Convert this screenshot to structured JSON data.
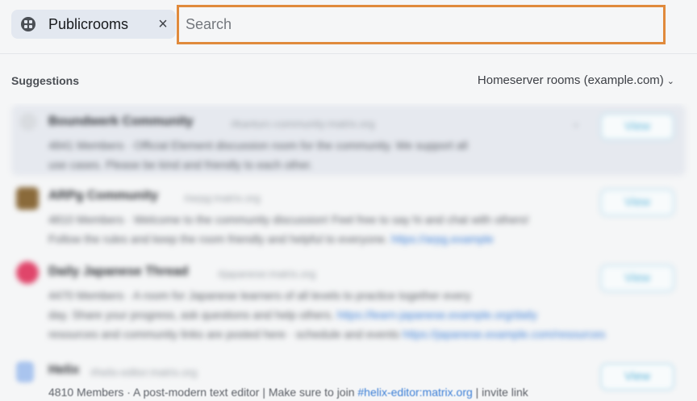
{
  "filter_chip": {
    "label": "Publicrooms",
    "icon": "public-rooms-icon",
    "close_symbol": "×"
  },
  "search": {
    "placeholder": "Search",
    "value": ""
  },
  "section": {
    "title": "Suggestions",
    "scope_label": "Homeserver rooms (example.com)",
    "scope_icon": "chevron-down-icon"
  },
  "colors": {
    "focus_border": "#e08a3c",
    "chip_bg": "#e3e8f0",
    "link": "#3c7fd6",
    "view_button": "#5ab3d8"
  },
  "results": [
    {
      "name": "Boundwerk Community",
      "alias": "#kanturc-community:matrix.org",
      "line1": "4841 Members · Official Element discussion room for the community. We support all",
      "line2": "use cases. Please be kind and friendly to each other.",
      "button": "View"
    },
    {
      "name": "ARPg Community",
      "alias": "#arpg:matrix.org",
      "line1": "4810 Members · Welcome to the community discussion! Feel free to say hi and chat with others!",
      "line2": "Follow the rules and keep the room friendly and helpful to everyone.",
      "line2_link": "https://arpg.example",
      "button": "View"
    },
    {
      "name": "Daily Japanese Thread",
      "alias": "#japanese:matrix.org",
      "line1": "4470 Members · A room for Japanese learners of all levels to practice together every",
      "line2": "day. Share your progress, ask questions and help others.",
      "line2_link": "https://learn-japanese.example.org/daily",
      "line3": "resources and community links are posted here · schedule and events",
      "line3_link": "https://japanese.example.com/resources",
      "button": "View"
    },
    {
      "name": "Helix",
      "alias": "#helix-editor:matrix.org",
      "line1": "4810 Members · A post-modern text editor | Make sure to join",
      "line1_link": "#helix-editor:matrix.org",
      "line1_tail": "| invite link",
      "button": "View"
    }
  ]
}
